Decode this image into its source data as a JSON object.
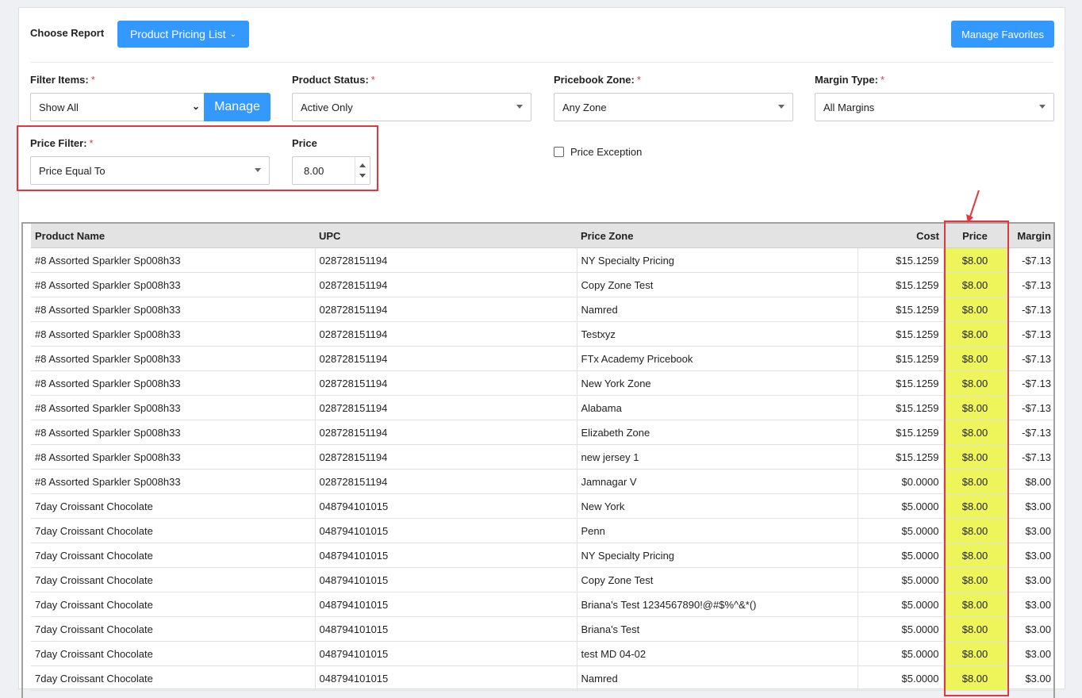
{
  "header": {
    "choose_report_label": "Choose Report",
    "report_dropdown_label": "Product Pricing List",
    "manage_favorites_label": "Manage Favorites"
  },
  "filters": {
    "filter_items": {
      "label": "Filter Items:",
      "required": "*",
      "value": "Show All",
      "manage_label": "Manage"
    },
    "product_status": {
      "label": "Product Status:",
      "required": "*",
      "value": "Active Only"
    },
    "pricebook_zone": {
      "label": "Pricebook Zone:",
      "required": "*",
      "value": "Any Zone"
    },
    "margin_type": {
      "label": "Margin Type:",
      "required": "*",
      "value": "All Margins"
    },
    "price_filter": {
      "label": "Price Filter:",
      "required": "*",
      "value": "Price Equal To"
    },
    "price": {
      "label": "Price",
      "value": "8.00"
    },
    "price_exception": {
      "label": "Price Exception",
      "checked": false
    }
  },
  "table": {
    "columns": [
      "Product Name",
      "UPC",
      "Price Zone",
      "Cost",
      "Price",
      "Margin"
    ],
    "rows": [
      [
        "#8 Assorted Sparkler Sp008h33",
        "028728151194",
        "NY Specialty Pricing",
        "$15.1259",
        "$8.00",
        "-$7.13"
      ],
      [
        "#8 Assorted Sparkler Sp008h33",
        "028728151194",
        "Copy Zone Test",
        "$15.1259",
        "$8.00",
        "-$7.13"
      ],
      [
        "#8 Assorted Sparkler Sp008h33",
        "028728151194",
        "Namred",
        "$15.1259",
        "$8.00",
        "-$7.13"
      ],
      [
        "#8 Assorted Sparkler Sp008h33",
        "028728151194",
        "Testxyz",
        "$15.1259",
        "$8.00",
        "-$7.13"
      ],
      [
        "#8 Assorted Sparkler Sp008h33",
        "028728151194",
        "FTx Academy Pricebook",
        "$15.1259",
        "$8.00",
        "-$7.13"
      ],
      [
        "#8 Assorted Sparkler Sp008h33",
        "028728151194",
        "New York Zone",
        "$15.1259",
        "$8.00",
        "-$7.13"
      ],
      [
        "#8 Assorted Sparkler Sp008h33",
        "028728151194",
        "Alabama",
        "$15.1259",
        "$8.00",
        "-$7.13"
      ],
      [
        "#8 Assorted Sparkler Sp008h33",
        "028728151194",
        "Elizabeth Zone",
        "$15.1259",
        "$8.00",
        "-$7.13"
      ],
      [
        "#8 Assorted Sparkler Sp008h33",
        "028728151194",
        "new jersey 1",
        "$15.1259",
        "$8.00",
        "-$7.13"
      ],
      [
        "#8 Assorted Sparkler Sp008h33",
        "028728151194",
        "Jamnagar V",
        "$0.0000",
        "$8.00",
        "$8.00"
      ],
      [
        "7day Croissant Chocolate",
        "048794101015",
        "New York",
        "$5.0000",
        "$8.00",
        "$3.00"
      ],
      [
        "7day Croissant Chocolate",
        "048794101015",
        "Penn",
        "$5.0000",
        "$8.00",
        "$3.00"
      ],
      [
        "7day Croissant Chocolate",
        "048794101015",
        "NY Specialty Pricing",
        "$5.0000",
        "$8.00",
        "$3.00"
      ],
      [
        "7day Croissant Chocolate",
        "048794101015",
        "Copy Zone Test",
        "$5.0000",
        "$8.00",
        "$3.00"
      ],
      [
        "7day Croissant Chocolate",
        "048794101015",
        "Briana's Test 1234567890!@#$%^&*()",
        "$5.0000",
        "$8.00",
        "$3.00"
      ],
      [
        "7day Croissant Chocolate",
        "048794101015",
        "Briana's Test",
        "$5.0000",
        "$8.00",
        "$3.00"
      ],
      [
        "7day Croissant Chocolate",
        "048794101015",
        "test MD 04-02",
        "$5.0000",
        "$8.00",
        "$3.00"
      ],
      [
        "7day Croissant Chocolate",
        "048794101015",
        "Namred",
        "$5.0000",
        "$8.00",
        "$3.00"
      ]
    ]
  },
  "colors": {
    "accent": "#3399ff",
    "highlight_box": "#e2373d",
    "price_cell_highlight": "#eef55a"
  }
}
